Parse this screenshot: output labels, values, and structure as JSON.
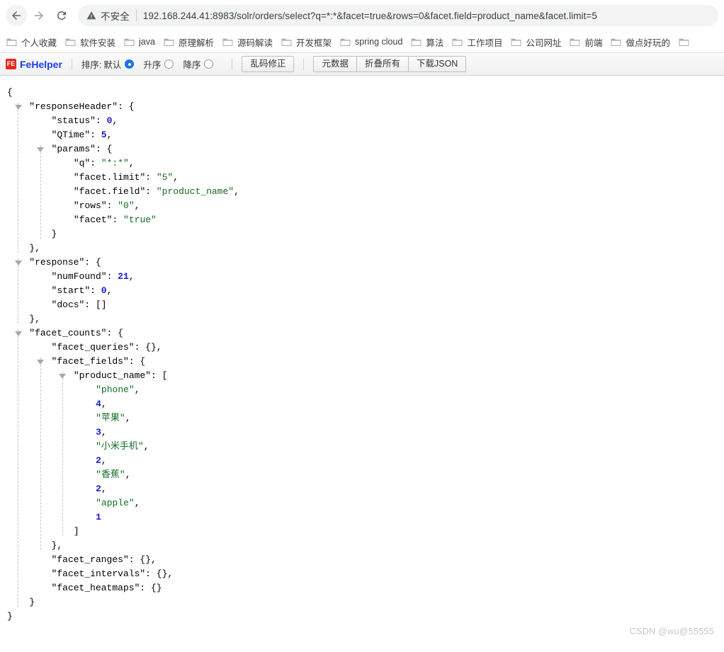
{
  "browser": {
    "back_label": "Back",
    "forward_label": "Forward",
    "reload_label": "Reload",
    "security_label": "不安全",
    "url": "192.168.244.41:8983/solr/orders/select?q=*:*&facet=true&rows=0&facet.field=product_name&facet.limit=5",
    "bookmarks": [
      {
        "label": "个人收藏"
      },
      {
        "label": "软件安装"
      },
      {
        "label": "java"
      },
      {
        "label": "原理解析"
      },
      {
        "label": "源码解读"
      },
      {
        "label": "开发框架"
      },
      {
        "label": "spring cloud"
      },
      {
        "label": "算法"
      },
      {
        "label": "工作项目"
      },
      {
        "label": "公司网址"
      },
      {
        "label": "前端"
      },
      {
        "label": "做点好玩的"
      }
    ]
  },
  "fehelper": {
    "logo_text": "FE",
    "name": "FeHelper",
    "sort_label": "排序:",
    "sort_options": [
      {
        "label": "默认",
        "selected": true
      },
      {
        "label": "升序",
        "selected": false
      },
      {
        "label": "降序",
        "selected": false
      }
    ],
    "fix_encoding_label": "乱码修正",
    "metadata_label": "元数据",
    "collapse_all_label": "折叠所有",
    "download_json_label": "下载JSON"
  },
  "json_lines": [
    {
      "indent": 0,
      "toggle": false,
      "parts": [
        {
          "t": "p",
          "v": "{"
        }
      ]
    },
    {
      "indent": 1,
      "toggle": true,
      "parts": [
        {
          "t": "k",
          "v": "\"responseHeader\""
        },
        {
          "t": "p",
          "v": ": {"
        }
      ]
    },
    {
      "indent": 2,
      "toggle": false,
      "parts": [
        {
          "t": "k",
          "v": "\"status\""
        },
        {
          "t": "p",
          "v": ": "
        },
        {
          "t": "n",
          "v": "0"
        },
        {
          "t": "p",
          "v": ","
        }
      ]
    },
    {
      "indent": 2,
      "toggle": false,
      "parts": [
        {
          "t": "k",
          "v": "\"QTime\""
        },
        {
          "t": "p",
          "v": ": "
        },
        {
          "t": "n",
          "v": "5"
        },
        {
          "t": "p",
          "v": ","
        }
      ]
    },
    {
      "indent": 2,
      "toggle": true,
      "parts": [
        {
          "t": "k",
          "v": "\"params\""
        },
        {
          "t": "p",
          "v": ": {"
        }
      ]
    },
    {
      "indent": 3,
      "toggle": false,
      "parts": [
        {
          "t": "k",
          "v": "\"q\""
        },
        {
          "t": "p",
          "v": ": "
        },
        {
          "t": "s",
          "v": "\"*:*\""
        },
        {
          "t": "p",
          "v": ","
        }
      ]
    },
    {
      "indent": 3,
      "toggle": false,
      "parts": [
        {
          "t": "k",
          "v": "\"facet.limit\""
        },
        {
          "t": "p",
          "v": ": "
        },
        {
          "t": "s",
          "v": "\"5\""
        },
        {
          "t": "p",
          "v": ","
        }
      ]
    },
    {
      "indent": 3,
      "toggle": false,
      "parts": [
        {
          "t": "k",
          "v": "\"facet.field\""
        },
        {
          "t": "p",
          "v": ": "
        },
        {
          "t": "s",
          "v": "\"product_name\""
        },
        {
          "t": "p",
          "v": ","
        }
      ]
    },
    {
      "indent": 3,
      "toggle": false,
      "parts": [
        {
          "t": "k",
          "v": "\"rows\""
        },
        {
          "t": "p",
          "v": ": "
        },
        {
          "t": "s",
          "v": "\"0\""
        },
        {
          "t": "p",
          "v": ","
        }
      ]
    },
    {
      "indent": 3,
      "toggle": false,
      "parts": [
        {
          "t": "k",
          "v": "\"facet\""
        },
        {
          "t": "p",
          "v": ": "
        },
        {
          "t": "s",
          "v": "\"true\""
        }
      ]
    },
    {
      "indent": 2,
      "toggle": false,
      "parts": [
        {
          "t": "p",
          "v": "}"
        }
      ]
    },
    {
      "indent": 1,
      "toggle": false,
      "parts": [
        {
          "t": "p",
          "v": "},"
        }
      ]
    },
    {
      "indent": 1,
      "toggle": true,
      "parts": [
        {
          "t": "k",
          "v": "\"response\""
        },
        {
          "t": "p",
          "v": ": {"
        }
      ]
    },
    {
      "indent": 2,
      "toggle": false,
      "parts": [
        {
          "t": "k",
          "v": "\"numFound\""
        },
        {
          "t": "p",
          "v": ": "
        },
        {
          "t": "n",
          "v": "21"
        },
        {
          "t": "p",
          "v": ","
        }
      ]
    },
    {
      "indent": 2,
      "toggle": false,
      "parts": [
        {
          "t": "k",
          "v": "\"start\""
        },
        {
          "t": "p",
          "v": ": "
        },
        {
          "t": "n",
          "v": "0"
        },
        {
          "t": "p",
          "v": ","
        }
      ]
    },
    {
      "indent": 2,
      "toggle": false,
      "parts": [
        {
          "t": "k",
          "v": "\"docs\""
        },
        {
          "t": "p",
          "v": ": []"
        }
      ]
    },
    {
      "indent": 1,
      "toggle": false,
      "parts": [
        {
          "t": "p",
          "v": "},"
        }
      ]
    },
    {
      "indent": 1,
      "toggle": true,
      "parts": [
        {
          "t": "k",
          "v": "\"facet_counts\""
        },
        {
          "t": "p",
          "v": ": {"
        }
      ]
    },
    {
      "indent": 2,
      "toggle": false,
      "parts": [
        {
          "t": "k",
          "v": "\"facet_queries\""
        },
        {
          "t": "p",
          "v": ": {},"
        }
      ]
    },
    {
      "indent": 2,
      "toggle": true,
      "parts": [
        {
          "t": "k",
          "v": "\"facet_fields\""
        },
        {
          "t": "p",
          "v": ": {"
        }
      ]
    },
    {
      "indent": 3,
      "toggle": true,
      "parts": [
        {
          "t": "k",
          "v": "\"product_name\""
        },
        {
          "t": "p",
          "v": ": ["
        }
      ]
    },
    {
      "indent": 4,
      "toggle": false,
      "parts": [
        {
          "t": "s",
          "v": "\"phone\""
        },
        {
          "t": "p",
          "v": ","
        }
      ]
    },
    {
      "indent": 4,
      "toggle": false,
      "parts": [
        {
          "t": "n",
          "v": "4"
        },
        {
          "t": "p",
          "v": ","
        }
      ]
    },
    {
      "indent": 4,
      "toggle": false,
      "parts": [
        {
          "t": "s",
          "v": "\"苹果\""
        },
        {
          "t": "p",
          "v": ","
        }
      ]
    },
    {
      "indent": 4,
      "toggle": false,
      "parts": [
        {
          "t": "n",
          "v": "3"
        },
        {
          "t": "p",
          "v": ","
        }
      ]
    },
    {
      "indent": 4,
      "toggle": false,
      "parts": [
        {
          "t": "s",
          "v": "\"小米手机\""
        },
        {
          "t": "p",
          "v": ","
        }
      ]
    },
    {
      "indent": 4,
      "toggle": false,
      "parts": [
        {
          "t": "n",
          "v": "2"
        },
        {
          "t": "p",
          "v": ","
        }
      ]
    },
    {
      "indent": 4,
      "toggle": false,
      "parts": [
        {
          "t": "s",
          "v": "\"香蕉\""
        },
        {
          "t": "p",
          "v": ","
        }
      ]
    },
    {
      "indent": 4,
      "toggle": false,
      "parts": [
        {
          "t": "n",
          "v": "2"
        },
        {
          "t": "p",
          "v": ","
        }
      ]
    },
    {
      "indent": 4,
      "toggle": false,
      "parts": [
        {
          "t": "s",
          "v": "\"apple\""
        },
        {
          "t": "p",
          "v": ","
        }
      ]
    },
    {
      "indent": 4,
      "toggle": false,
      "parts": [
        {
          "t": "n",
          "v": "1"
        }
      ]
    },
    {
      "indent": 3,
      "toggle": false,
      "parts": [
        {
          "t": "p",
          "v": "]"
        }
      ]
    },
    {
      "indent": 2,
      "toggle": false,
      "parts": [
        {
          "t": "p",
          "v": "},"
        }
      ]
    },
    {
      "indent": 2,
      "toggle": false,
      "parts": [
        {
          "t": "k",
          "v": "\"facet_ranges\""
        },
        {
          "t": "p",
          "v": ": {},"
        }
      ]
    },
    {
      "indent": 2,
      "toggle": false,
      "parts": [
        {
          "t": "k",
          "v": "\"facet_intervals\""
        },
        {
          "t": "p",
          "v": ": {},"
        }
      ]
    },
    {
      "indent": 2,
      "toggle": false,
      "parts": [
        {
          "t": "k",
          "v": "\"facet_heatmaps\""
        },
        {
          "t": "p",
          "v": ": {}"
        }
      ]
    },
    {
      "indent": 1,
      "toggle": false,
      "parts": [
        {
          "t": "p",
          "v": "}"
        }
      ]
    },
    {
      "indent": 0,
      "toggle": false,
      "parts": [
        {
          "t": "p",
          "v": "}"
        }
      ]
    }
  ],
  "json_guides": [
    {
      "indent": 1,
      "from": 1,
      "to": 11
    },
    {
      "indent": 2,
      "from": 4,
      "to": 10
    },
    {
      "indent": 1,
      "from": 12,
      "to": 16
    },
    {
      "indent": 1,
      "from": 17,
      "to": 36
    },
    {
      "indent": 2,
      "from": 19,
      "to": 32
    },
    {
      "indent": 3,
      "from": 20,
      "to": 31
    }
  ],
  "watermark": "CSDN @wu@55555",
  "colors": {
    "accent": "#1a73e8",
    "brand": "#1a3df0",
    "logo_bg": "#e8261c",
    "string": "#136c23",
    "number": "#1a1acc"
  }
}
